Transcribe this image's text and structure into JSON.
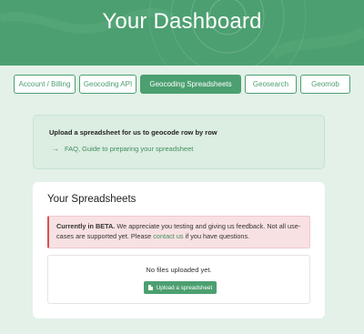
{
  "header": {
    "title": "Your Dashboard"
  },
  "tabs": [
    {
      "label": "Account / Billing",
      "active": false
    },
    {
      "label": "Geocoding API",
      "active": false
    },
    {
      "label": "Geocoding Spreadsheets",
      "active": true
    },
    {
      "label": "Geosearch",
      "active": false
    },
    {
      "label": "Geomob",
      "active": false
    }
  ],
  "info": {
    "title": "Upload a spreadsheet for us to geocode row by row",
    "link_icon": "arrow-right-icon",
    "link_label": "FAQ, Guide to preparing your spreadsheet"
  },
  "spreadsheets": {
    "title": "Your Spreadsheets",
    "beta_bold": "Currently in BETA.",
    "beta_text": " We appreciate you testing and giving us feedback. Not all use-cases are supported yet. Please ",
    "beta_link": "contact us",
    "beta_tail": " if you have questions.",
    "empty_text": "No files uploaded yet.",
    "upload_label": "Upload a spreadsheet",
    "upload_icon": "document-icon"
  },
  "colors": {
    "brand": "#4c9f70",
    "background": "#e3f1e8",
    "alert_bg": "#f8e1e2",
    "alert_border": "#d9534f"
  }
}
